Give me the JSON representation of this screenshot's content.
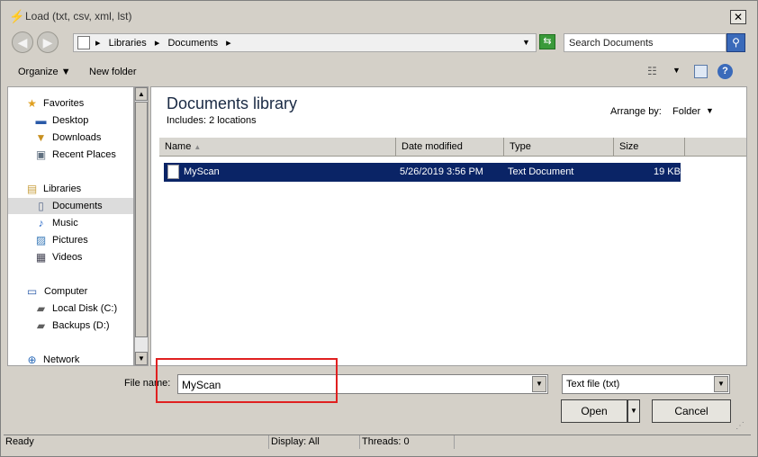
{
  "window": {
    "title": "Load (txt, csv, xml, lst)",
    "close_glyph": "✕"
  },
  "address": {
    "crumbs": [
      "Libraries",
      "Documents"
    ],
    "separator": "▸",
    "search_placeholder": "Search Documents"
  },
  "toolbar": {
    "organize": "Organize",
    "new_folder": "New folder"
  },
  "nav": {
    "items": [
      {
        "label": "Favorites",
        "icon": "star-icon"
      },
      {
        "label": "Desktop",
        "icon": "desktop-icon"
      },
      {
        "label": "Downloads",
        "icon": "downloads-icon"
      },
      {
        "label": "Recent Places",
        "icon": "recent-places-icon"
      },
      {
        "label": "Libraries",
        "icon": "libraries-icon"
      },
      {
        "label": "Documents",
        "icon": "documents-icon"
      },
      {
        "label": "Music",
        "icon": "music-icon"
      },
      {
        "label": "Pictures",
        "icon": "pictures-icon"
      },
      {
        "label": "Videos",
        "icon": "videos-icon"
      },
      {
        "label": "Computer",
        "icon": "computer-icon"
      },
      {
        "label": "Local Disk (C:)",
        "icon": "disk-icon"
      },
      {
        "label": "Backups (D:)",
        "icon": "disk-icon"
      },
      {
        "label": "Network",
        "icon": "network-icon"
      }
    ],
    "selected": "Documents"
  },
  "content": {
    "title": "Documents library",
    "subtitle": "Includes:  2 locations",
    "arrange_label": "Arrange by:",
    "arrange_value": "Folder",
    "columns": [
      "Name",
      "Date modified",
      "Type",
      "Size"
    ],
    "rows": [
      {
        "name": "MyScan",
        "date": "5/26/2019 3:56 PM",
        "type": "Text Document",
        "size": "19 KB"
      }
    ]
  },
  "bottom": {
    "filename_label": "File name:",
    "filename_value": "MyScan",
    "filetype_value": "Text file (txt)",
    "open_label": "Open",
    "cancel_label": "Cancel"
  },
  "status": {
    "ready": "Ready",
    "display": "Display: All",
    "threads": "Threads: 0"
  },
  "colors": {
    "selection": "#0a2466",
    "highlight_box": "#e02020"
  }
}
